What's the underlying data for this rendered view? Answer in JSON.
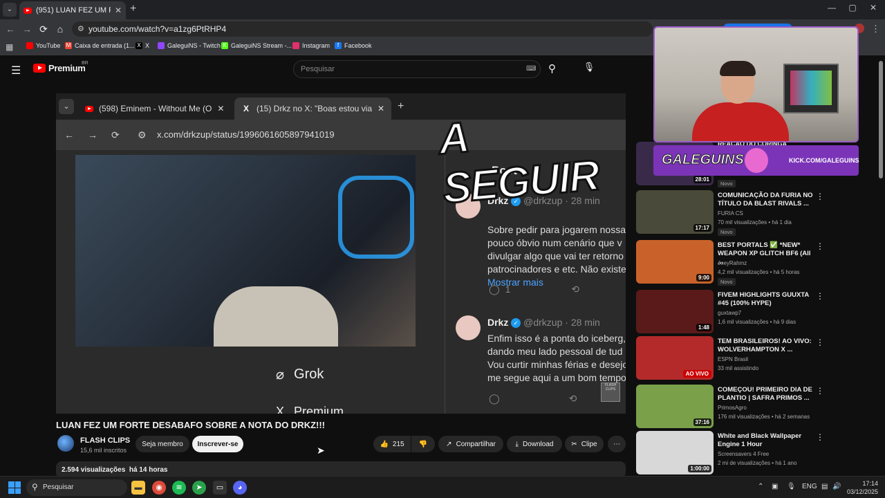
{
  "browser": {
    "tab_title": "(951) LUAN FEZ UM FORTE DES",
    "url": "youtube.com/watch?v=a1zg6PtRHP4",
    "new_tab_glyph": "+",
    "window_controls": [
      "—",
      "▢",
      "✕"
    ]
  },
  "bookmarks": [
    {
      "label": "YouTube",
      "color": "#ff0000",
      "glyph": ""
    },
    {
      "label": "Caixa de entrada (1...",
      "color": "#ea4335",
      "glyph": "M"
    },
    {
      "label": "X",
      "color": "#000000",
      "glyph": "X"
    },
    {
      "label": "GaleguiNS - Twitch",
      "color": "#9146ff",
      "glyph": ""
    },
    {
      "label": "GaleguiNS Stream -...",
      "color": "#53fc18",
      "glyph": "K"
    },
    {
      "label": "Instagram",
      "color": "#e1306c",
      "glyph": ""
    },
    {
      "label": "Facebook",
      "color": "#1877f2",
      "glyph": "f"
    }
  ],
  "youtube": {
    "logo_text": "Premium",
    "region": "BR",
    "search_placeholder": "Pesquisar"
  },
  "player": {
    "inner_tabs": [
      "(598) Eminem - Without Me (O",
      "(15) Drkz no X: \"Boas estou via"
    ],
    "inner_url": "x.com/drkzup/status/1996061605897941019",
    "overlay_text": "A SEGUIR",
    "post_header": "Post",
    "grok_label": "Grok",
    "premium_label": "Premium",
    "watermark": "FLASH CLIPS",
    "tweets": [
      {
        "name": "Drkz",
        "handle": "@drkzup · 28 min",
        "body": "Sobre pedir para jogarem nossa\npouco óbvio num cenário que v\ndivulgar algo que vai ter retorno\npatrocinadores e etc. Não existe",
        "more": "Mostrar mais",
        "replies": "1"
      },
      {
        "name": "Drkz",
        "handle": "@drkzup · 28 min",
        "body": "Enfim isso é a ponta do iceberg,\ndando meu lado pessoal de tud\nVou curtir minhas férias e desejo\nme segue aqui a um bom tempo"
      }
    ]
  },
  "video": {
    "title": "LUAN FEZ UM FORTE DESABAFO SOBRE A NOTA DO DRKZ!!!",
    "channel": "FLASH CLIPS",
    "subscribers": "15,6 mil inscritos",
    "join_label": "Seja membro",
    "subscribe_label": "Inscrever-se",
    "likes": "215",
    "share_label": "Compartilhar",
    "download_label": "Download",
    "clip_label": "Clipe",
    "views": "2.594 visualizações",
    "age": "há 14 horas"
  },
  "overlay": {
    "kick_brand": "GALEGUINS",
    "kick_url": "KICK.COM/GALEGUINS",
    "partial_title": "REAÇÃO DO CORINGA"
  },
  "sidebar": [
    {
      "title": "",
      "channel": "",
      "meta": "",
      "badge": "Novo",
      "duration": "28:01",
      "thumb": "#3a2a4a"
    },
    {
      "title": "COMUNICAÇÃO DA FURIA NO TÍTULO DA BLAST RIVALS ...",
      "channel": "FURIA CS",
      "meta": "70 mil visualizações  •  há 1 dia",
      "badge": "Novo",
      "duration": "17:17",
      "thumb": "#4a4a3a"
    },
    {
      "title": "BEST PORTALS ✅ *NEW* WEAPON XP GLITCH BF6 (All ...",
      "channel": "JoeyRahmz",
      "meta": "4,2 mil visualizações  •  há 5 horas",
      "badge": "Novo",
      "duration": "9:00",
      "thumb": "#c8622a"
    },
    {
      "title": "FIVEM HIGHLIGHTS GUUXTA #45 (100% HYPE)",
      "channel": "guxtawp7",
      "meta": "1,6 mil visualizações  •  há 9 dias",
      "badge": "",
      "duration": "1:48",
      "thumb": "#5a1a1a"
    },
    {
      "title": "TEM BRASILEIROS! AO VIVO: WOLVERHAMPTON X ...",
      "channel": "ESPN Brasil",
      "meta": "33 mil assistindo",
      "badge": "",
      "duration": "AO VIVO",
      "thumb": "#b42a2a"
    },
    {
      "title": "COMEÇOU! PRIMEIRO DIA DE PLANTIO | SAFRA PRIMOS ...",
      "channel": "PrimosAgro",
      "meta": "176 mil visualizações  •  há 2 semanas",
      "badge": "",
      "duration": "37:16",
      "thumb": "#7aa04a"
    },
    {
      "title": "White and Black Wallpaper Engine 1 Hour",
      "channel": "Screensavers 4 Free",
      "meta": "2 mi de visualizações  •  há 1 ano",
      "badge": "",
      "duration": "1:00:00",
      "thumb": "#d8d8d8"
    }
  ],
  "taskbar": {
    "search_label": "Pesquisar",
    "lang": "ENG",
    "time": "17:14",
    "date": "03/12/2025"
  }
}
